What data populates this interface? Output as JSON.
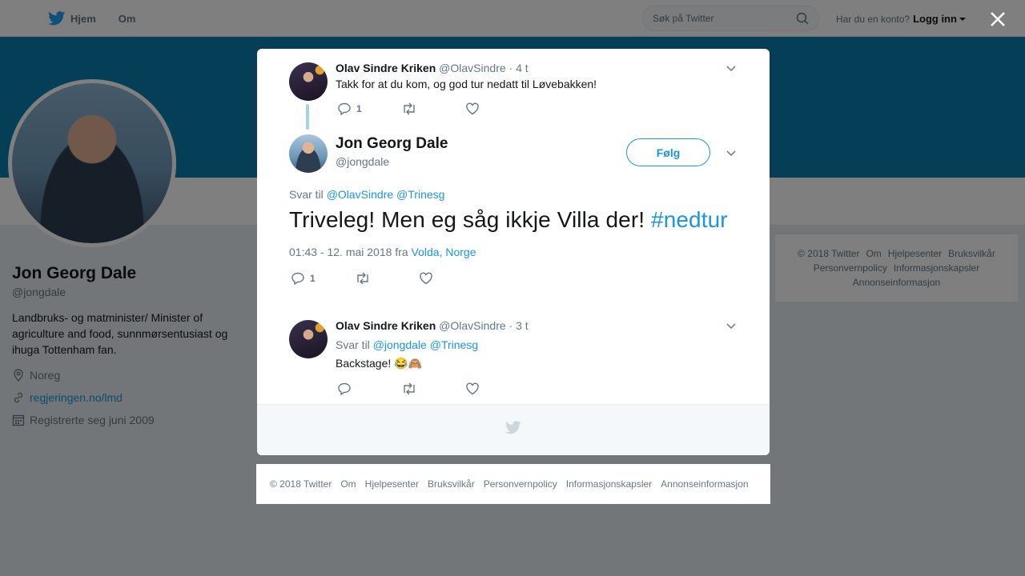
{
  "nav": {
    "home": "Hjem",
    "about": "Om"
  },
  "search": {
    "placeholder": "Søk på Twitter"
  },
  "login": {
    "question": "Har du en konto?",
    "link": "Logg inn"
  },
  "profile": {
    "name": "Jon Georg Dale",
    "handle": "@jongdale",
    "bio": "Landbruks- og matminister/ Minister of agriculture and food, sunnmørsentusiast og ihuga Tottenham fan.",
    "location": "Noreg",
    "website": "regjeringen.no/lmd",
    "joined": "Registrerte seg juni 2009"
  },
  "right_footer": [
    "© 2018 Twitter",
    "Om",
    "Hjelpesenter",
    "Bruksvilkår",
    "Personvernpolicy",
    "Informasjonskapsler",
    "Annonseinformasjon"
  ],
  "modal": {
    "parent": {
      "name": "Olav Sindre Kriken",
      "handle": "@OlavSindre",
      "time": "· 4 t",
      "text": "Takk for at du kom, og god tur nedatt til Løvebakken!",
      "replies": "1"
    },
    "main": {
      "name": "Jon Georg Dale",
      "handle": "@jongdale",
      "follow": "Følg",
      "reply_prefix": "Svar til",
      "mention1": "@OlavSindre",
      "mention2": "@Trinesg",
      "text": "Triveleg! Men eg såg ikkje Villa der!",
      "hashtag": "#nedtur",
      "meta": "01:43 - 12. mai 2018 fra",
      "location": "Volda, Norge",
      "replies": "1"
    },
    "reply": {
      "name": "Olav Sindre Kriken",
      "handle": "@OlavSindre",
      "time": "· 3 t",
      "reply_prefix": "Svar til",
      "mention1": "@jongdale",
      "mention2": "@Trinesg",
      "text": "Backstage! 😂🙈"
    }
  },
  "bottom_footer": [
    "© 2018 Twitter",
    "Om",
    "Hjelpesenter",
    "Bruksvilkår",
    "Personvernpolicy",
    "Informasjonskapsler",
    "Annonseinformasjon"
  ],
  "colors": {
    "link": "#1b95e0",
    "banner": "#0b7fae",
    "overlay": "rgba(0,0,0,0.5)"
  }
}
